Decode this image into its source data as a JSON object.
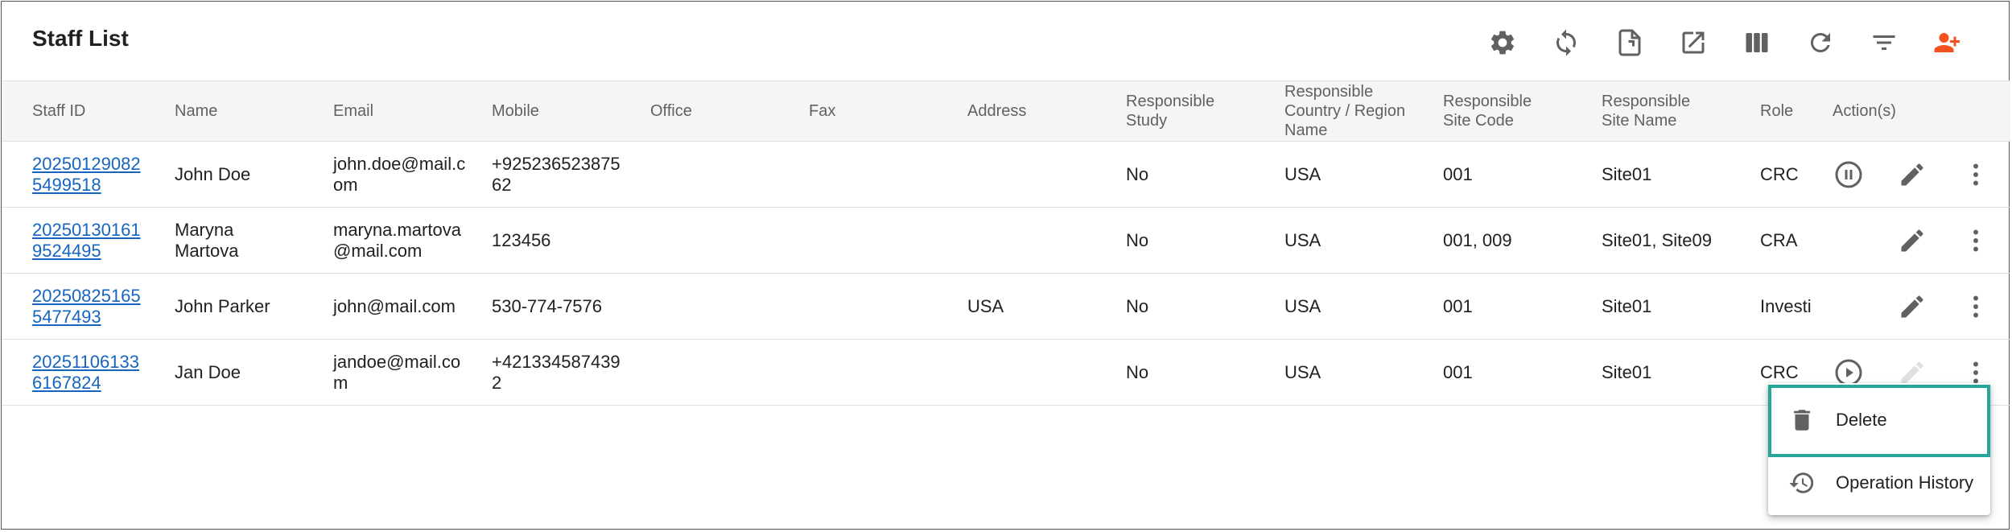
{
  "title": "Staff List",
  "toolbar": {
    "icons": [
      "gear-icon",
      "sync-icon",
      "export-file-icon",
      "open-external-icon",
      "columns-icon",
      "refresh-icon",
      "filter-icon",
      "add-user-icon"
    ],
    "accent": "#f4511e",
    "icon_color": "#616161"
  },
  "columns": {
    "staff_id": "Staff ID",
    "name": "Name",
    "email": "Email",
    "mobile": "Mobile",
    "office": "Office",
    "fax": "Fax",
    "address": "Address",
    "responsible_study": "Responsible Study",
    "responsible_country": "Responsible Country / Region Name",
    "site_code": "Responsible Site Code",
    "site_name": "Responsible Site Name",
    "role": "Role",
    "actions": "Action(s)"
  },
  "rows": [
    {
      "staff_id": "202501290825499518",
      "name": "John Doe",
      "email": "john.doe@mail.com",
      "mobile": "+92523652387562",
      "office": "",
      "fax": "",
      "address": "",
      "study": "No",
      "country": "USA",
      "site_code": "001",
      "site_name": "Site01",
      "role": "CRC",
      "status_action": "pause"
    },
    {
      "staff_id": "202501301619524495",
      "name": "Maryna Martova",
      "email": "maryna.martova@mail.com",
      "mobile": "123456",
      "office": "",
      "fax": "",
      "address": "",
      "study": "No",
      "country": "USA",
      "site_code": "001, 009",
      "site_name": "Site01, Site09",
      "role": "CRA",
      "status_action": ""
    },
    {
      "staff_id": "202508251655477493",
      "name": "John Parker",
      "email": "john@mail.com",
      "mobile": "530-774-7576",
      "office": "",
      "fax": "",
      "address": "USA",
      "study": "No",
      "country": "USA",
      "site_code": "001",
      "site_name": "Site01",
      "role": "Investi",
      "status_action": ""
    },
    {
      "staff_id": "202511061336167824",
      "name": "Jan Doe",
      "email": "jandoe@mail.com",
      "mobile": "+4213345874392",
      "office": "",
      "fax": "",
      "address": "",
      "study": "No",
      "country": "USA",
      "site_code": "001",
      "site_name": "Site01",
      "role": "CRC",
      "status_action": "play"
    }
  ],
  "menu": {
    "delete_label": "Delete",
    "history_label": "Operation History"
  },
  "highlight_color": "#26a69a"
}
